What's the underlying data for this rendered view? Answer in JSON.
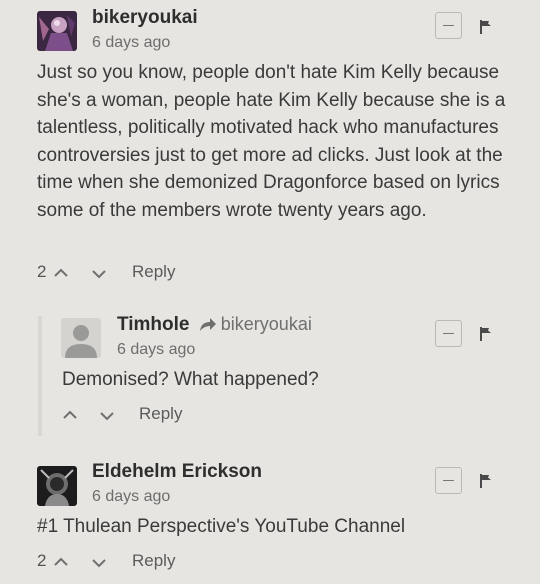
{
  "comments": [
    {
      "author": "bikeryoukai",
      "time": "6 days ago",
      "text": "Just so you know, people don't hate Kim Kelly because she's a woman, people hate Kim Kelly because she is a talentless, politically motivated hack who manufactures controversies just to get more ad clicks. Just look at the time when she demonized Dragonforce based on lyrics some of the members wrote twenty years ago.",
      "votes": "2",
      "reply_label": "Reply"
    },
    {
      "author": "Timhole",
      "reply_to": "bikeryoukai",
      "time": "6 days ago",
      "text": "Demonised? What happened?",
      "votes": "",
      "reply_label": "Reply"
    },
    {
      "author": "Eldehelm Erickson",
      "time": "6 days ago",
      "text": "#1 Thulean Perspective's YouTube Channel",
      "votes": "2",
      "reply_label": "Reply"
    }
  ],
  "icons": {
    "collapse": "minus-icon",
    "flag": "flag-icon",
    "upvote": "chevron-up-icon",
    "downvote": "chevron-down-icon",
    "reply_to": "share-arrow-icon"
  }
}
